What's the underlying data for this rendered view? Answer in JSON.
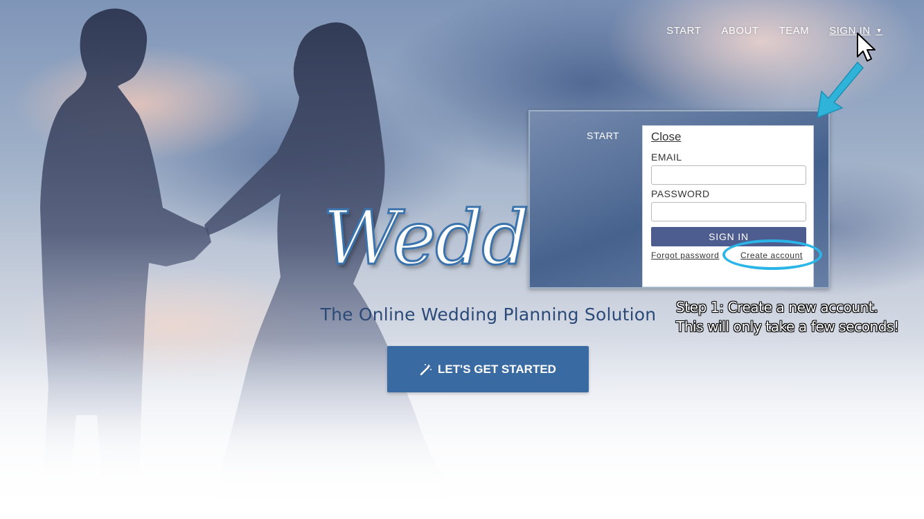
{
  "nav": {
    "items": [
      {
        "label": "START"
      },
      {
        "label": "ABOUT"
      },
      {
        "label": "TEAM"
      },
      {
        "label": "SIGN IN"
      }
    ]
  },
  "hero": {
    "logo_text": "Wedd",
    "tagline": "The Online Wedding Planning Solution",
    "cta_label": "LET'S GET STARTED",
    "cta_icon": "magic-wand-icon"
  },
  "login_panel": {
    "start_label": "START",
    "close_label": "Close",
    "email_label": "EMAIL",
    "email_value": "",
    "password_label": "PASSWORD",
    "password_value": "",
    "signin_label": "SIGN IN",
    "forgot_label": "Forgot password",
    "create_label": "Create account"
  },
  "annotation": {
    "line1": "Step 1: Create a new account.",
    "line2": "This will only take a few seconds!"
  },
  "colors": {
    "primary": "#3a6aa2",
    "signin_button": "#4e5d8f",
    "highlight": "#29b5e8",
    "tagline": "#2b4a78"
  }
}
